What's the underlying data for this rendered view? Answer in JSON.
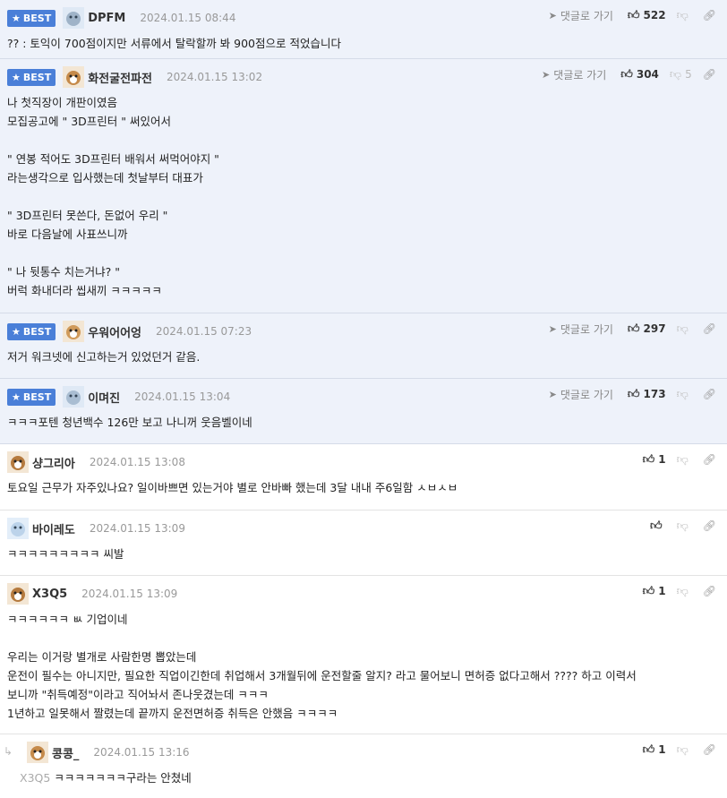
{
  "labels": {
    "best": "BEST",
    "reply_link": "댓글로 가기"
  },
  "comments": [
    {
      "best": true,
      "nick": "DPFM",
      "date": "2024.01.15 08:44",
      "up": "522",
      "down": "",
      "show_reply": true,
      "body": "?? : 토익이 700점이지만 서류에서 탈락할까 봐 900점으로 적었습니다"
    },
    {
      "best": true,
      "nick": "화전굴전파전",
      "date": "2024.01.15 13:02",
      "up": "304",
      "down": "5",
      "show_reply": true,
      "body": "나 첫직장이 개판이였음\n모집공고에 \" 3D프린터 \" 써있어서\n\n\" 연봉 적어도 3D프린터 배워서 써먹어야지 \"\n라는생각으로 입사했는데 첫날부터 대표가\n\n\" 3D프린터 못쓴다, 돈없어 우리 \"\n바로 다음날에 사표쓰니까\n\n\" 나 뒷통수 치는거냐? \"\n버럭 화내더라 씹새끼 ㅋㅋㅋㅋㅋ"
    },
    {
      "best": true,
      "nick": "우워어어엉",
      "date": "2024.01.15 07:23",
      "up": "297",
      "down": "",
      "show_reply": true,
      "body": "저거 워크넷에 신고하는거 있었던거 같음."
    },
    {
      "best": true,
      "nick": "이며진",
      "date": "2024.01.15 13:04",
      "up": "173",
      "down": "",
      "show_reply": true,
      "body": "ㅋㅋㅋ포텐 청년백수 126만 보고 나니꺼 웃음벨이네"
    },
    {
      "best": false,
      "nick": "샹그리아",
      "date": "2024.01.15 13:08",
      "up": "1",
      "down": "",
      "show_reply": false,
      "body": "토요일 근무가 자주있나요? 일이바쁘면 있는거야 별로 안바빠 했는데 3달 내내 주6일함 ㅅㅂㅅㅂ"
    },
    {
      "best": false,
      "nick": "바이레도",
      "date": "2024.01.15 13:09",
      "up": "",
      "down": "",
      "show_reply": false,
      "body": "ㅋㅋㅋㅋㅋㅋㅋㅋㅋ 씨발"
    },
    {
      "best": false,
      "nick": "X3Q5",
      "date": "2024.01.15 13:09",
      "up": "1",
      "down": "",
      "show_reply": false,
      "body": "ㅋㅋㅋㅋㅋㅋ ㅄ 기업이네\n\n우리는 이거랑 별개로 사람한명 뽑았는데\n운전이 필수는 아니지만, 필요한 직업이긴한데 취업해서 3개월뒤에 운전할줄 알지? 라고 물어보니 면허증 없다고해서 ???? 하고 이력서\n보니까 \"취득예정\"이라고 직어놔서 존나웃겼는데 ㅋㅋㅋ\n1년하고 일못해서 짤렸는데 끝까지 운전면허증 취득은 안했음 ㅋㅋㅋㅋ"
    },
    {
      "best": false,
      "reply": true,
      "nick": "콩콩_",
      "date": "2024.01.15 13:16",
      "up": "1",
      "down": "",
      "show_reply": false,
      "mention": "X3Q5",
      "body": "ㅋㅋㅋㅋㅋㅋㅋ구라는 안쳤네"
    }
  ]
}
